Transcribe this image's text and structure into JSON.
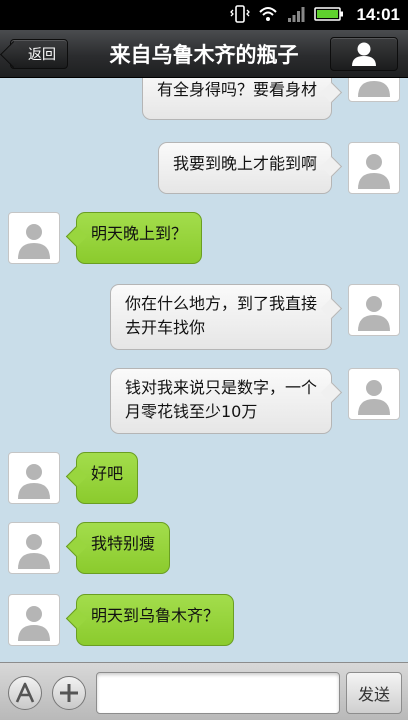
{
  "status_bar": {
    "time": "14:01"
  },
  "header": {
    "back_label": "返回",
    "title": "来自乌鲁木齐的瓶子"
  },
  "messages": [
    {
      "side": "right",
      "text": "有全身得吗？要看身材"
    },
    {
      "side": "right",
      "text": "我要到晚上才能到啊"
    },
    {
      "side": "left",
      "text": "明天晚上到？"
    },
    {
      "side": "right",
      "text": "你在什么地方，到了我直接\n去开车找你"
    },
    {
      "side": "right",
      "text": "钱对我来说只是数字，一个\n月零花钱至少10万"
    },
    {
      "side": "left",
      "text": "好吧"
    },
    {
      "side": "left",
      "text": "我特别瘦"
    },
    {
      "side": "left",
      "text": "明天到乌鲁木齐？"
    }
  ],
  "input_bar": {
    "text_value": "",
    "send_label": "发送"
  },
  "icons": {
    "vibrate": "vibrate-icon",
    "wifi": "wifi-icon",
    "signal": "signal-icon",
    "battery": "battery-icon",
    "profile": "person-icon",
    "font": "font-a-icon",
    "add": "plus-icon"
  },
  "colors": {
    "chat_background": "#c9dde9",
    "incoming_bubble": "#99d63e",
    "outgoing_bubble": "#f0f0f0",
    "title_bar": "#2b2c2e"
  }
}
